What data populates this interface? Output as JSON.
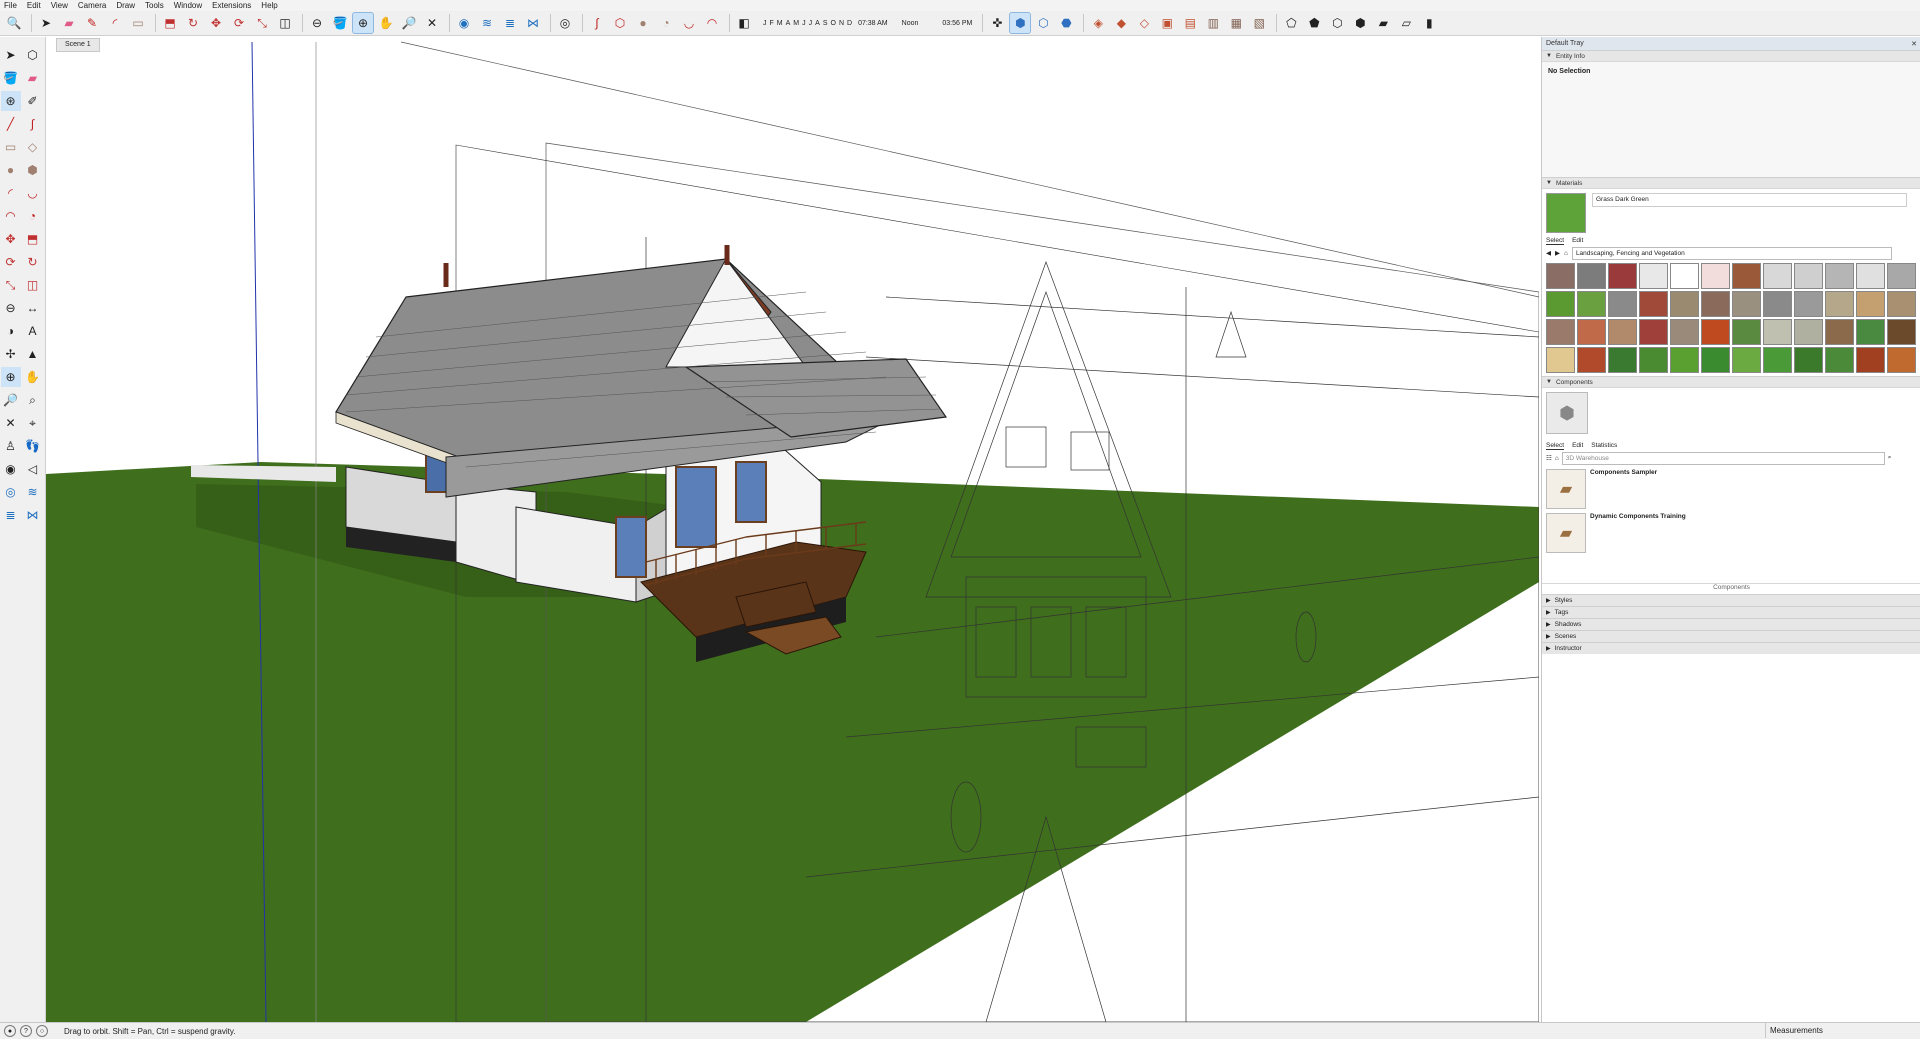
{
  "menu": [
    "File",
    "Edit",
    "View",
    "Camera",
    "Draw",
    "Tools",
    "Window",
    "Extensions",
    "Help"
  ],
  "toolbar": {
    "months": [
      "J",
      "F",
      "M",
      "A",
      "M",
      "J",
      "J",
      "A",
      "S",
      "O",
      "N",
      "D"
    ],
    "time_start": "07:38 AM",
    "noon": "Noon",
    "time_end": "03:56 PM"
  },
  "scene": {
    "tab": "Scene 1"
  },
  "status": {
    "hint": "Drag to orbit. Shift = Pan, Ctrl = suspend gravity.",
    "measurements": "Measurements"
  },
  "tray": {
    "title": "Default Tray",
    "entity": {
      "title": "Entity Info",
      "selection": "No Selection"
    },
    "materials": {
      "title": "Materials",
      "current": "Grass Dark Green",
      "tab_select": "Select",
      "tab_edit": "Edit",
      "library": "Landscaping, Fencing and Vegetation"
    },
    "components": {
      "title": "Components",
      "tab_select": "Select",
      "tab_edit": "Edit",
      "tab_stats": "Statistics",
      "search_placeholder": "3D Warehouse",
      "items": [
        "Components Sampler",
        "Dynamic Components Training"
      ],
      "footer": "Components"
    },
    "collapsed": [
      "Styles",
      "Tags",
      "Shadows",
      "Scenes",
      "Instructor"
    ]
  },
  "colors": {
    "grass": "#3f6e1c",
    "sky": "#ffffff",
    "roof": "#8c8c8c",
    "wood": "#7a4a25",
    "accent": "#cde3f7"
  }
}
